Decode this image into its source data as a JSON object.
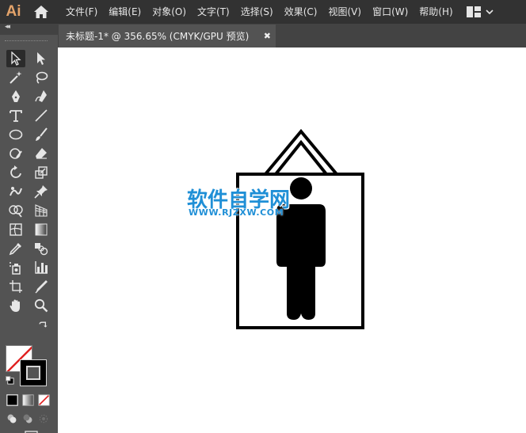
{
  "app": {
    "logo": "Ai"
  },
  "menu": {
    "items": [
      "文件(F)",
      "编辑(E)",
      "对象(O)",
      "文字(T)",
      "选择(S)",
      "效果(C)",
      "视图(V)",
      "窗口(W)",
      "帮助(H)"
    ]
  },
  "toolbar": {
    "collapse_label": "◂◂"
  },
  "document": {
    "tab_title": "未标题-1* @ 356.65% (CMYK/GPU 预览)",
    "close_label": "✖"
  },
  "watermark": {
    "title": "软件自学网",
    "url": "WWW.RJZXW.COM"
  },
  "colors": {
    "menubar": "#323232",
    "panel": "#535353",
    "canvas": "#ffffff",
    "logo": "#e3a36a",
    "watermark": "#1f8fd6",
    "fill_none_slash": "#e02020"
  },
  "icons": [
    "home-icon",
    "workspace-icon",
    "chevron-down-icon"
  ]
}
